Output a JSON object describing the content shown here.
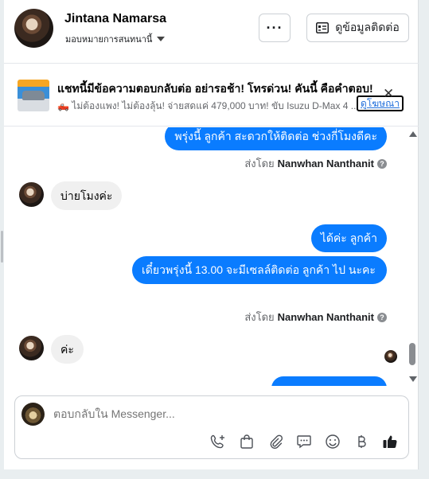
{
  "header": {
    "name": "Jintana Namarsa",
    "assign_label": "มอบหมายการสนทนานี้",
    "more_label": "···",
    "info_button_label": "ดูข้อมูลติดต่อ"
  },
  "ad": {
    "title": "แชทนี้มีข้อความตอบกลับต่อ อย่ารอช้า! โทรด่วน! คันนี้ คือคำตอบ!",
    "subtitle_prefix": "🛻",
    "subtitle": " ไม่ต้องแพง! ไม่ต้องลุ้น! จ่ายสดแค่ 479,000 บาท! ขับ Isuzu D-Max 4 ...",
    "link_label": "ดูโฆษณา",
    "close_label": "✕"
  },
  "thread": {
    "messages": [
      {
        "direction": "out",
        "text": "พรุ่งนี้ ลูกค้า  สะดวกให้ติดต่อ ช่วงกี่โมงดีคะ"
      },
      {
        "direction": "meta",
        "prefix": "ส่งโดย",
        "author": "Nanwhan Nanthanit",
        "icon": "?"
      },
      {
        "direction": "in",
        "text": "บ่ายโมงค่ะ"
      },
      {
        "direction": "out",
        "text": "ได้ค่ะ  ลูกค้า"
      },
      {
        "direction": "out",
        "text": "เดี๋ยวพรุ่งนี้ 13.00 จะมีเซลล์ติดต่อ ลูกค้า  ไป นะคะ"
      },
      {
        "direction": "meta",
        "prefix": "ส่งโดย",
        "author": "Nanwhan Nanthanit",
        "icon": "?"
      },
      {
        "direction": "in",
        "text": "ค่ะ"
      }
    ]
  },
  "composer": {
    "placeholder": "ตอบกลับใน Messenger..."
  },
  "colors": {
    "outgoing_bubble": "#0a7cff",
    "incoming_bubble": "#f0f0f0",
    "link": "#216fdb"
  }
}
